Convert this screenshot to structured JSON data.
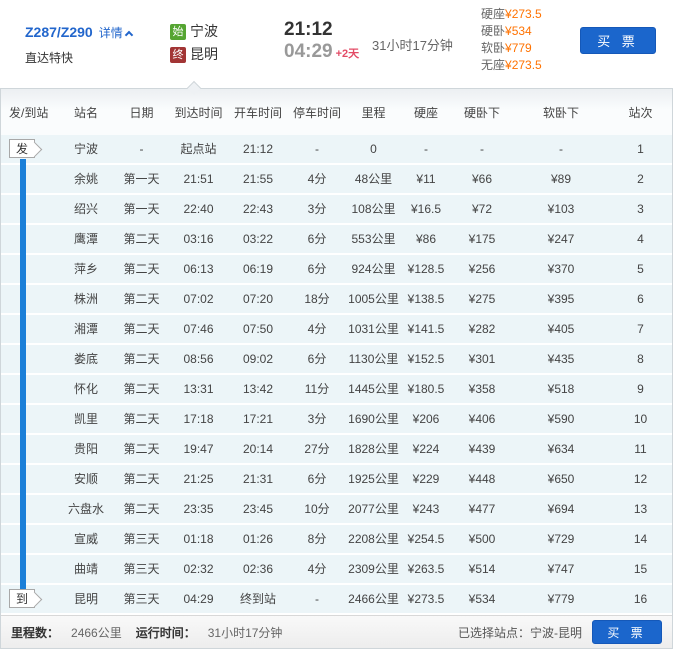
{
  "colors": {
    "link-blue": "#2266cc",
    "buy-blue": "#1b66cc",
    "price-orange": "#ff7200",
    "start-green": "#55a532",
    "end-red": "#a23535",
    "day-offset-pink": "#e34b66",
    "timeline-blue": "#1b7fd8",
    "row-bg": "#ecf5f8"
  },
  "header": {
    "train_no": "Z287/Z290",
    "detail_label": "详情",
    "train_type": "直达特快",
    "start_badge": "始",
    "start_station": "宁波",
    "end_badge": "终",
    "end_station": "昆明",
    "depart_time": "21:12",
    "arrive_time": "04:29",
    "arrive_day_offset": "+2天",
    "duration": "31小时17分钟",
    "prices": [
      {
        "label": "硬座",
        "value": "¥273.5"
      },
      {
        "label": "硬卧",
        "value": "¥534"
      },
      {
        "label": "软卧",
        "value": "¥779"
      },
      {
        "label": "无座",
        "value": "¥273.5"
      }
    ],
    "buy_button": "买 票"
  },
  "table": {
    "columns": [
      "发/到站",
      "站名",
      "日期",
      "到达时间",
      "开车时间",
      "停车时间",
      "里程",
      "硬座",
      "硬卧下",
      "软卧下",
      "站次"
    ],
    "depart_marker": "发",
    "arrive_marker": "到",
    "rows": [
      [
        "宁波",
        "-",
        "起点站",
        "21:12",
        "-",
        "0",
        "-",
        "-",
        "-",
        "1"
      ],
      [
        "余姚",
        "第一天",
        "21:51",
        "21:55",
        "4分",
        "48公里",
        "¥11",
        "¥66",
        "¥89",
        "2"
      ],
      [
        "绍兴",
        "第一天",
        "22:40",
        "22:43",
        "3分",
        "108公里",
        "¥16.5",
        "¥72",
        "¥103",
        "3"
      ],
      [
        "鹰潭",
        "第二天",
        "03:16",
        "03:22",
        "6分",
        "553公里",
        "¥86",
        "¥175",
        "¥247",
        "4"
      ],
      [
        "萍乡",
        "第二天",
        "06:13",
        "06:19",
        "6分",
        "924公里",
        "¥128.5",
        "¥256",
        "¥370",
        "5"
      ],
      [
        "株洲",
        "第二天",
        "07:02",
        "07:20",
        "18分",
        "1005公里",
        "¥138.5",
        "¥275",
        "¥395",
        "6"
      ],
      [
        "湘潭",
        "第二天",
        "07:46",
        "07:50",
        "4分",
        "1031公里",
        "¥141.5",
        "¥282",
        "¥405",
        "7"
      ],
      [
        "娄底",
        "第二天",
        "08:56",
        "09:02",
        "6分",
        "1130公里",
        "¥152.5",
        "¥301",
        "¥435",
        "8"
      ],
      [
        "怀化",
        "第二天",
        "13:31",
        "13:42",
        "11分",
        "1445公里",
        "¥180.5",
        "¥358",
        "¥518",
        "9"
      ],
      [
        "凯里",
        "第二天",
        "17:18",
        "17:21",
        "3分",
        "1690公里",
        "¥206",
        "¥406",
        "¥590",
        "10"
      ],
      [
        "贵阳",
        "第二天",
        "19:47",
        "20:14",
        "27分",
        "1828公里",
        "¥224",
        "¥439",
        "¥634",
        "11"
      ],
      [
        "安顺",
        "第二天",
        "21:25",
        "21:31",
        "6分",
        "1925公里",
        "¥229",
        "¥448",
        "¥650",
        "12"
      ],
      [
        "六盘水",
        "第二天",
        "23:35",
        "23:45",
        "10分",
        "2077公里",
        "¥243",
        "¥477",
        "¥694",
        "13"
      ],
      [
        "宣威",
        "第三天",
        "01:18",
        "01:26",
        "8分",
        "2208公里",
        "¥254.5",
        "¥500",
        "¥729",
        "14"
      ],
      [
        "曲靖",
        "第三天",
        "02:32",
        "02:36",
        "4分",
        "2309公里",
        "¥263.5",
        "¥514",
        "¥747",
        "15"
      ],
      [
        "昆明",
        "第三天",
        "04:29",
        "终到站",
        "-",
        "2466公里",
        "¥273.5",
        "¥534",
        "¥779",
        "16"
      ]
    ]
  },
  "footer": {
    "mileage_label": "里程数：",
    "mileage_value": "2466公里",
    "duration_label": "运行时间：",
    "duration_value": "31小时17分钟",
    "selected_label": "已选择站点：宁波-昆明",
    "buy_button": "买 票"
  }
}
